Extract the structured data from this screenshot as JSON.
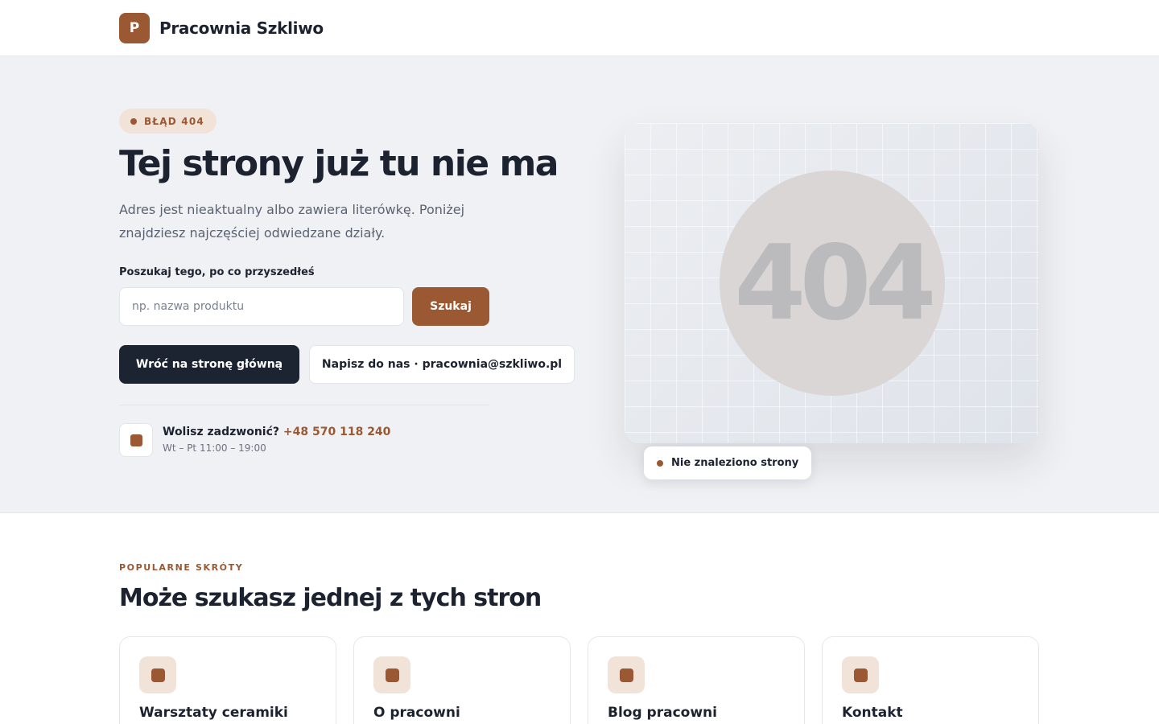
{
  "header": {
    "logo_letter": "P",
    "brand": "Pracownia Szkliwo"
  },
  "hero": {
    "badge": "BŁĄD 404",
    "title": "Tej strony już tu nie ma",
    "subtitle": "Adres jest nieaktualny albo zawiera literówkę. Poniżej znajdziesz najczęściej odwiedzane działy.",
    "search": {
      "label": "Poszukaj tego, po co przyszedłeś",
      "placeholder": "np. nazwa produktu",
      "value": "",
      "button": "Szukaj"
    },
    "home_button": "Wróć na stronę główną",
    "mail_button": "Napisz do nas · pracownia@szkliwo.pl",
    "phone": {
      "question": "Wolisz zadzwonić?",
      "number": "+48 570 118 240",
      "hours": "Wt – Pt 11:00 – 19:00"
    },
    "illustration": {
      "code": "404",
      "caption": "Nie znaleziono strony"
    }
  },
  "popular": {
    "eyebrow": "POPULARNE SKRÓTY",
    "title": "Może szukasz jednej z tych stron",
    "cards": [
      {
        "title": "Warsztaty ceramiki"
      },
      {
        "title": "O pracowni"
      },
      {
        "title": "Blog pracowni"
      },
      {
        "title": "Kontakt"
      }
    ]
  },
  "colors": {
    "accent": "#9a5833",
    "accent_soft": "#f1e3d8",
    "dark": "#1c2331",
    "hero_bg": "#f0f1f4"
  }
}
